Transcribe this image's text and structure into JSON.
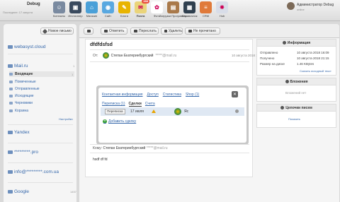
{
  "brand": {
    "title": "Debug",
    "subtitle": "Последнее: 17 августа"
  },
  "apps": [
    {
      "label": "Контакты",
      "color": "#7a8aa0",
      "glyph": "☺",
      "icon": "contacts-icon"
    },
    {
      "label": "Инсталлер",
      "color": "#3a4a5e",
      "glyph": "▣",
      "icon": "installer-icon"
    },
    {
      "label": "Магазин",
      "color": "#4aa0d8",
      "glyph": "⌂",
      "icon": "store-icon"
    },
    {
      "label": "Сайт",
      "color": "#59a8e0",
      "glyph": "◉",
      "icon": "site-icon"
    },
    {
      "label": "Блоги",
      "color": "#e8b400",
      "glyph": "✎",
      "icon": "blog-icon"
    },
    {
      "label": "Почта",
      "color": "#ead47a",
      "glyph": "✉",
      "icon": "mail-icon",
      "active": true,
      "badge": "288"
    },
    {
      "label": "Фото",
      "color": "#ffffff",
      "glyph": "✿",
      "icon": "photos-icon"
    },
    {
      "label": "Загрузки Программы",
      "color": "#a9794a",
      "glyph": "▤",
      "icon": "files-icon"
    },
    {
      "label": "Справочник",
      "color": "#2f3f4e",
      "glyph": "▦",
      "icon": "reference-icon"
    },
    {
      "label": "CRM",
      "color": "#e07a3a",
      "glyph": "≡",
      "icon": "crm-icon"
    },
    {
      "label": "Hub",
      "color": "#d8dde8",
      "glyph": "✸",
      "icon": "hub-icon"
    }
  ],
  "user": {
    "name": "Администратор Debug",
    "status": "online"
  },
  "sidebar": {
    "new_mail": "Новое письмо",
    "accounts": [
      {
        "name": "webasyst.cloud",
        "count": ""
      },
      {
        "name": "Mail.ru",
        "count": "1"
      }
    ],
    "folders": [
      {
        "label": "Входящие",
        "count": "1",
        "selected": true
      },
      {
        "label": "Помеченные",
        "count": ""
      },
      {
        "label": "Отправленные",
        "count": ""
      },
      {
        "label": "Исходящие",
        "count": ""
      },
      {
        "label": "Черновики",
        "count": ""
      },
      {
        "label": "Корзина",
        "count": ""
      }
    ],
    "settings_link": "Настройки",
    "other_accounts": [
      {
        "name": "Yandex",
        "count": ""
      },
      {
        "name": "*********.pro",
        "count": ""
      },
      {
        "name": "info@*********.com.ua",
        "count": ""
      },
      {
        "name": "Google",
        "count": "1457"
      }
    ]
  },
  "toolbar": {
    "reply": "Ответить",
    "forward": "Переслать",
    "delete": "Удалить",
    "unread": "Не прочитано"
  },
  "message": {
    "subject": "dfdfdsfsd",
    "from_label": "От:",
    "from_name": "Степан Екатеринбургский",
    "from_email": "*****@mail.ru",
    "date": "10 августа 2018 16:09",
    "to_label": "Кому:",
    "to_name": "Степан Екатеринбургский",
    "to_email": "*****@mail.ru",
    "body": "hsdf df fd"
  },
  "popup": {
    "top_tabs": [
      "Контактная информация",
      "Доступ",
      "Статистика",
      "Shop (1)"
    ],
    "sub_tabs": [
      {
        "label": "Переписка (1)",
        "selected": false
      },
      {
        "label": "Сделки",
        "selected": true
      },
      {
        "label": "Счета",
        "selected": false
      }
    ],
    "row": {
      "tag": "Переписка",
      "date": "17 июля",
      "who": "Яс"
    },
    "add_deal": "Добавить сделку"
  },
  "info": {
    "title": "Информация",
    "rows": [
      {
        "k": "Отправлено",
        "v": "10 августа 2018 16:09"
      },
      {
        "k": "Получено",
        "v": "10 августа 2018 21:15"
      },
      {
        "k": "Размер на диске",
        "v": "1.46 KBytes"
      }
    ],
    "source_link": "Скачать исходный текст",
    "attachments_title": "Вложения",
    "attachments_empty": "Вложений нет",
    "chain_title": "Цепочки писем",
    "chain_link": "Показать"
  }
}
